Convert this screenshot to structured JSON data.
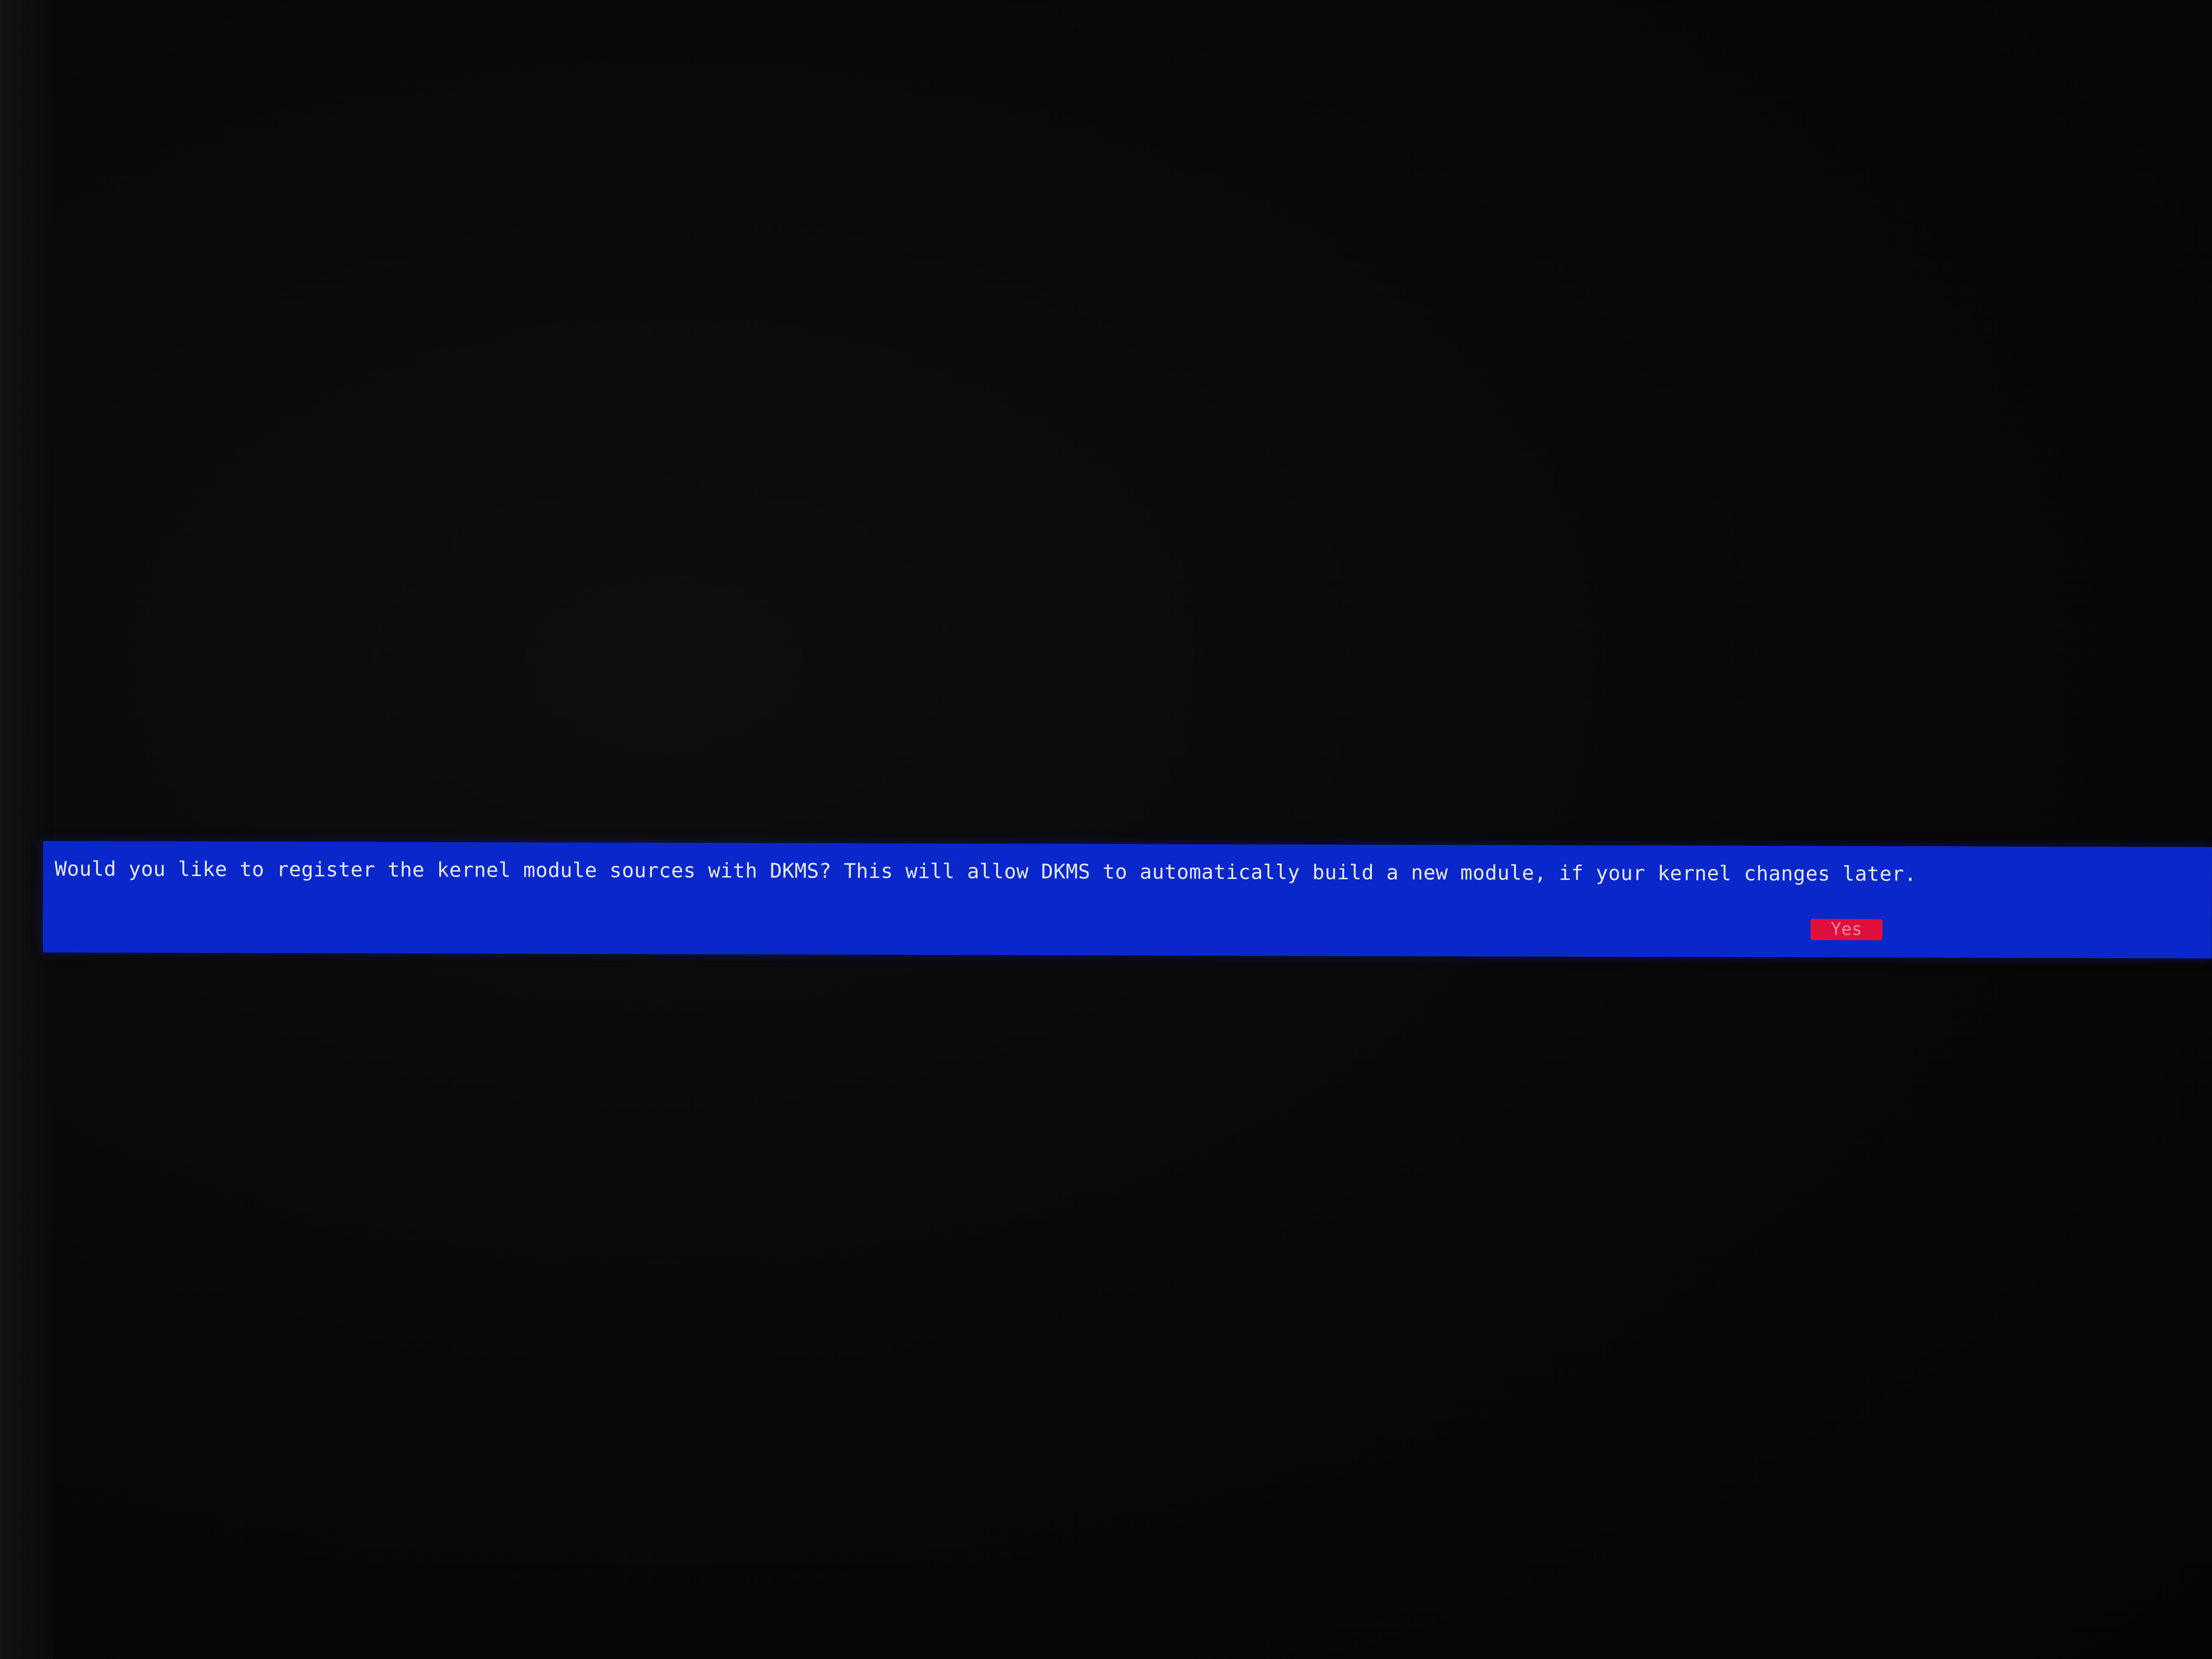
{
  "dialog": {
    "message": "Would you like to register the kernel module sources with DKMS? This will allow DKMS to automatically build a new module, if your kernel changes later.",
    "yes_label": "Yes"
  },
  "colors": {
    "dialog_background": "#0a27cc",
    "message_text": "#e6e9f6",
    "button_background": "#e0103c",
    "screen_background": "#070707"
  }
}
